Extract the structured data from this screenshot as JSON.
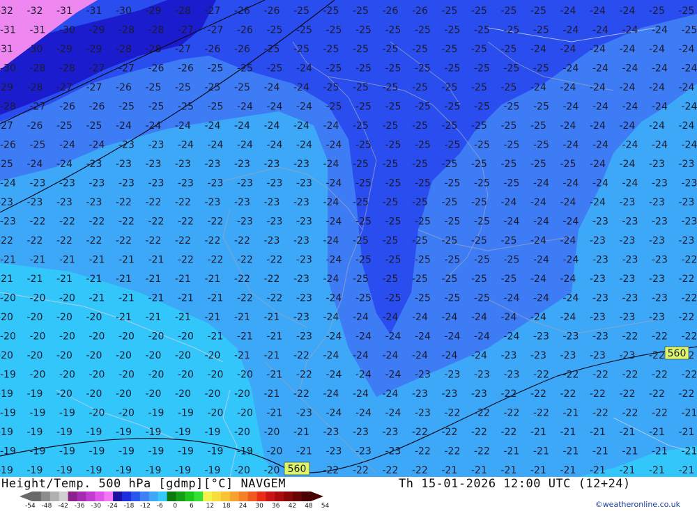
{
  "header": {
    "left_title": "Height/Temp. 500 hPa [gdmp][°C] NAVGEM",
    "right_title": "Th 15-01-2026 12:00 UTC (12+24)"
  },
  "credit": "©weatheronline.co.uk",
  "colors": {
    "pink": "#ee88f0",
    "navy": "#1c1ccf",
    "blue_dark": "#2a4df0",
    "blue_mid": "#3e7cf6",
    "blue_light": "#3da8f8",
    "cyan": "#33c6fb",
    "contour_label_bg": "#ddf56a"
  },
  "contour_labels": [
    "560",
    "560"
  ],
  "colorbar": {
    "tick_labels": [
      "-54",
      "-48",
      "-42",
      "-36",
      "-30",
      "-24",
      "-18",
      "-12",
      "-6",
      "0",
      "6",
      "12",
      "18",
      "24",
      "30",
      "36",
      "42",
      "48",
      "54"
    ],
    "colors": [
      "#6a6a6a",
      "#8c8c8c",
      "#b0b0b0",
      "#d0d0d0",
      "#8c1f8c",
      "#a62bb0",
      "#c23cd2",
      "#df55ec",
      "#f277f5",
      "#1a12a0",
      "#1e2ce0",
      "#2a56f0",
      "#3d80f6",
      "#3fa6f8",
      "#35c8fb",
      "#0c7a0c",
      "#139f13",
      "#1cc41c",
      "#35e035",
      "#f2f24a",
      "#f7dc3c",
      "#f8c435",
      "#f7a22e",
      "#f48028",
      "#f05a20",
      "#e82c18",
      "#c81414",
      "#a80c0c",
      "#880808",
      "#680404",
      "#4a0202"
    ]
  },
  "temperature_rows": [
    [
      -32,
      -32,
      -31,
      -31,
      -30,
      -29,
      -28,
      -27,
      -26,
      -26,
      -25,
      -25,
      -25,
      -26,
      -26,
      -25,
      -25,
      -25,
      -25,
      -24,
      -24,
      -24,
      -25,
      -25
    ],
    [
      -31,
      -31,
      -30,
      -29,
      -28,
      -28,
      -27,
      -27,
      -26,
      -25,
      -25,
      -25,
      -25,
      -25,
      -25,
      -25,
      -25,
      -25,
      -25,
      -24,
      -24,
      -24,
      -24,
      -25
    ],
    [
      -31,
      -30,
      -29,
      -29,
      -28,
      -28,
      -27,
      -26,
      -26,
      -25,
      -25,
      -25,
      -25,
      -25,
      -25,
      -25,
      -25,
      -25,
      -24,
      -24,
      -24,
      -24,
      -24,
      -24
    ],
    [
      -30,
      -28,
      -28,
      -27,
      -27,
      -26,
      -26,
      -25,
      -25,
      -25,
      -24,
      -25,
      -25,
      -25,
      -25,
      -25,
      -25,
      -25,
      -25,
      -24,
      -24,
      -24,
      -24,
      -24
    ],
    [
      -29,
      -28,
      -27,
      -27,
      -26,
      -25,
      -25,
      -25,
      -25,
      -24,
      -24,
      -25,
      -25,
      -25,
      -25,
      -25,
      -25,
      -25,
      -24,
      -24,
      -24,
      -24,
      -24,
      -24
    ],
    [
      -28,
      -27,
      -26,
      -26,
      -25,
      -25,
      -25,
      -25,
      -24,
      -24,
      -24,
      -25,
      -25,
      -25,
      -25,
      -25,
      -25,
      -25,
      -25,
      -24,
      -24,
      -24,
      -24,
      -24
    ],
    [
      -27,
      -26,
      -25,
      -25,
      -24,
      -24,
      -24,
      -24,
      -24,
      -24,
      -24,
      -24,
      -25,
      -25,
      -25,
      -25,
      -25,
      -25,
      -25,
      -24,
      -24,
      -24,
      -24,
      -24
    ],
    [
      -26,
      -25,
      -24,
      -24,
      -23,
      -23,
      -24,
      -24,
      -24,
      -24,
      -24,
      -24,
      -25,
      -25,
      -25,
      -25,
      -25,
      -25,
      -25,
      -24,
      -24,
      -24,
      -24,
      -24
    ],
    [
      -25,
      -24,
      -24,
      -23,
      -23,
      -23,
      -23,
      -23,
      -23,
      -23,
      -23,
      -24,
      -25,
      -25,
      -25,
      -25,
      -25,
      -25,
      -25,
      -25,
      -24,
      -24,
      -23,
      -23
    ],
    [
      -24,
      -23,
      -23,
      -23,
      -23,
      -23,
      -23,
      -23,
      -23,
      -23,
      -23,
      -24,
      -25,
      -25,
      -25,
      -25,
      -25,
      -25,
      -24,
      -24,
      -24,
      -24,
      -23,
      -23
    ],
    [
      -23,
      -23,
      -23,
      -23,
      -22,
      -22,
      -22,
      -23,
      -23,
      -23,
      -23,
      -24,
      -25,
      -25,
      -25,
      -25,
      -25,
      -24,
      -24,
      -24,
      -24,
      -23,
      -23,
      -23
    ],
    [
      -23,
      -22,
      -22,
      -22,
      -22,
      -22,
      -22,
      -22,
      -23,
      -23,
      -23,
      -24,
      -25,
      -25,
      -25,
      -25,
      -25,
      -24,
      -24,
      -24,
      -23,
      -23,
      -23,
      -23
    ],
    [
      -22,
      -22,
      -22,
      -22,
      -22,
      -22,
      -22,
      -22,
      -22,
      -23,
      -23,
      -24,
      -25,
      -25,
      -25,
      -25,
      -25,
      -25,
      -24,
      -24,
      -23,
      -23,
      -23,
      -23
    ],
    [
      -21,
      -21,
      -21,
      -21,
      -21,
      -21,
      -22,
      -22,
      -22,
      -22,
      -23,
      -24,
      -25,
      -25,
      -25,
      -25,
      -25,
      -25,
      -24,
      -24,
      -23,
      -23,
      -23,
      -22
    ],
    [
      -21,
      -21,
      -21,
      -21,
      -21,
      -21,
      -21,
      -21,
      -22,
      -22,
      -23,
      -24,
      -25,
      -25,
      -25,
      -25,
      -25,
      -25,
      -24,
      -24,
      -23,
      -23,
      -23,
      -22
    ],
    [
      -20,
      -20,
      -20,
      -21,
      -21,
      -21,
      -21,
      -21,
      -22,
      -22,
      -23,
      -24,
      -25,
      -25,
      -25,
      -25,
      -25,
      -24,
      -24,
      -24,
      -23,
      -23,
      -23,
      -22
    ],
    [
      -20,
      -20,
      -20,
      -20,
      -21,
      -21,
      -21,
      -21,
      -21,
      -21,
      -23,
      -24,
      -24,
      -24,
      -24,
      -24,
      -24,
      -24,
      -24,
      -24,
      -23,
      -23,
      -23,
      -22
    ],
    [
      -20,
      -20,
      -20,
      -20,
      -20,
      -20,
      -20,
      -21,
      -21,
      -21,
      -23,
      -24,
      -24,
      -24,
      -24,
      -24,
      -24,
      -24,
      -23,
      -23,
      -23,
      -22,
      -22,
      -22
    ],
    [
      -20,
      -20,
      -20,
      -20,
      -20,
      -20,
      -20,
      -20,
      -21,
      -21,
      -22,
      -24,
      -24,
      -24,
      -24,
      -24,
      -24,
      -23,
      -23,
      -23,
      -23,
      -23,
      -22,
      -22
    ],
    [
      -19,
      -20,
      -20,
      -20,
      -20,
      -20,
      -20,
      -20,
      -20,
      -21,
      -22,
      -24,
      -24,
      -24,
      -23,
      -23,
      -23,
      -23,
      -22,
      -22,
      -22,
      -22,
      -22,
      -22
    ],
    [
      -19,
      -19,
      -20,
      -20,
      -20,
      -20,
      -20,
      -20,
      -20,
      -21,
      -22,
      -24,
      -24,
      -24,
      -23,
      -23,
      -23,
      -22,
      -22,
      -22,
      -22,
      -22,
      -22,
      -22
    ],
    [
      -19,
      -19,
      -19,
      -20,
      -20,
      -19,
      -19,
      -20,
      -20,
      -21,
      -23,
      -24,
      -24,
      -24,
      -23,
      -22,
      -22,
      -22,
      -22,
      -21,
      -22,
      -22,
      -22,
      -21
    ],
    [
      -19,
      -19,
      -19,
      -19,
      -19,
      -19,
      -19,
      -19,
      -20,
      -20,
      -21,
      -23,
      -23,
      -23,
      -22,
      -22,
      -22,
      -22,
      -21,
      -21,
      -21,
      -21,
      -21,
      -21
    ],
    [
      -19,
      -19,
      -19,
      -19,
      -19,
      -19,
      -19,
      -19,
      -19,
      -20,
      -21,
      -23,
      -23,
      -23,
      -22,
      -22,
      -22,
      -21,
      -21,
      -21,
      -21,
      -21,
      -21,
      -21
    ],
    [
      -19,
      -19,
      -19,
      -19,
      -19,
      -19,
      -19,
      -19,
      -20,
      -20,
      -21,
      -22,
      -22,
      -22,
      -22,
      -21,
      -21,
      -21,
      -21,
      -21,
      -21,
      -21,
      -21,
      -21
    ]
  ]
}
